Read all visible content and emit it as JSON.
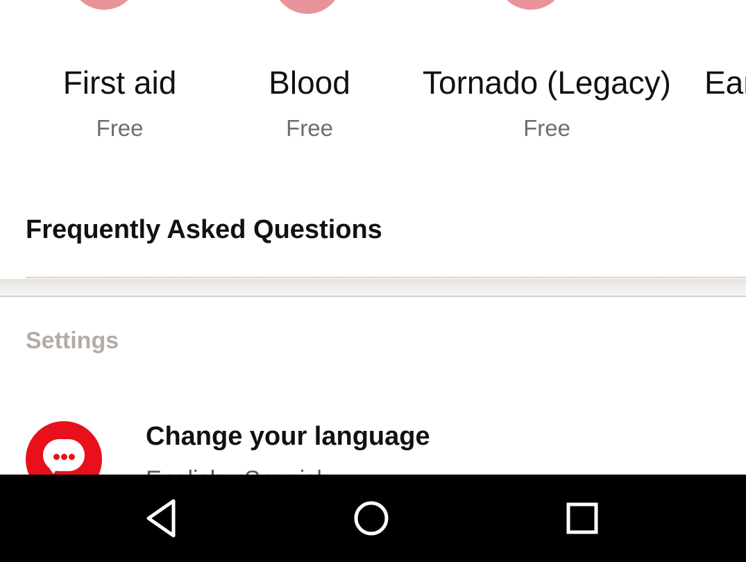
{
  "apps": [
    {
      "name": "First aid",
      "price": "Free"
    },
    {
      "name": "Blood",
      "price": "Free"
    },
    {
      "name": "Tornado (Legacy)",
      "price": "Free"
    },
    {
      "name": "Ear",
      "price": ""
    }
  ],
  "faq": {
    "label": "Frequently Asked Questions"
  },
  "settings": {
    "header": "Settings",
    "language": {
      "title": "Change your language",
      "subtitle": "English • Spanish",
      "icon": "chat-bubble-icon"
    }
  },
  "navbar": {
    "icons": [
      "back-triangle-icon",
      "home-circle-icon",
      "recents-square-icon"
    ]
  },
  "colors": {
    "accent_red": "#e8111b",
    "thumb_pink": "#e8939a",
    "muted_header": "#b3aba6"
  }
}
